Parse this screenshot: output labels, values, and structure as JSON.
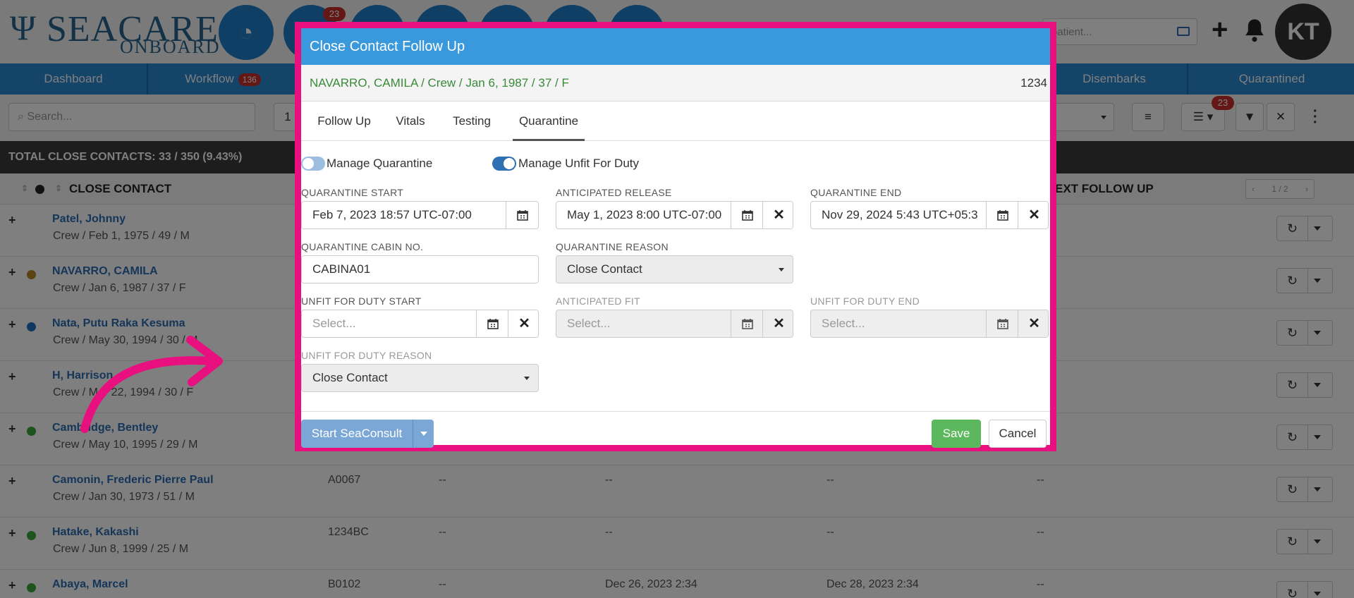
{
  "app": {
    "logo_mark": "Ψ",
    "logo_main": "SEACARE",
    "logo_sub": "ONBOARD",
    "header_badge": "23",
    "search_placeholder": "patient...",
    "user_initials": "KT"
  },
  "nav": {
    "dashboard": "Dashboard",
    "workflow": "Workflow",
    "workflow_badge": "136",
    "disembarks": "Disembarks",
    "quarantined": "Quarantined"
  },
  "toolbar": {
    "search_placeholder": "Search...",
    "list_badge": "23",
    "partial_value": "1"
  },
  "list": {
    "summary": "TOTAL CLOSE CONTACTS: 33 / 350 (9.43%)",
    "col_close_contact": "CLOSE CONTACT",
    "col_next_follow_up": "EXT FOLLOW UP",
    "pager": "1 / 2",
    "rows": [
      {
        "name": "Patel, Johnny",
        "sub": "Crew / Feb 1, 1975 / 49 / M",
        "cabin": "",
        "c1": "",
        "c2": "",
        "c3": "",
        "c4": "",
        "dot": ""
      },
      {
        "name": "NAVARRO, CAMILA",
        "sub": "Crew / Jan 6, 1987 / 37 / F",
        "cabin": "",
        "c1": "",
        "c2": "",
        "c3": "",
        "c4": "",
        "dot": "#b8872a"
      },
      {
        "name": "Nata, Putu Raka Kesuma",
        "sub": "Crew / May 30, 1994 / 30 / M",
        "cabin": "",
        "c1": "",
        "c2": "",
        "c3": "",
        "c4": "",
        "dot": "#1e6fc0"
      },
      {
        "name": "H, Harrison",
        "sub": "Crew / Mar 22, 1994 / 30 / F",
        "cabin": "",
        "c1": "",
        "c2": "",
        "c3": "",
        "c4": "",
        "dot": ""
      },
      {
        "name": "Cambridge, Bentley",
        "sub": "Crew / May 10, 1995 / 29 / M",
        "cabin": "",
        "c1": "",
        "c2": "",
        "c3": "",
        "c4": "",
        "dot": "#3aa83a"
      },
      {
        "name": "Camonin, Frederic Pierre Paul",
        "sub": "Crew / Jan 30, 1973 / 51 / M",
        "cabin": "A0067",
        "c1": "--",
        "c2": "--",
        "c3": "--",
        "c4": "--",
        "dot": ""
      },
      {
        "name": "Hatake, Kakashi",
        "sub": "Crew / Jun 8, 1999 / 25 / M",
        "cabin": "1234BC",
        "c1": "--",
        "c2": "--",
        "c3": "--",
        "c4": "--",
        "dot": "#3aa83a"
      },
      {
        "name": "Abaya, Marcel",
        "sub": "",
        "cabin": "B0102",
        "c1": "--",
        "c2": "Dec 26, 2023 2:34",
        "c3": "Dec 28, 2023 2:34",
        "c4": "--",
        "dot": "#3aa83a"
      }
    ]
  },
  "modal": {
    "title": "Close Contact Follow Up",
    "patient_info": "NAVARRO, CAMILA / Crew / Jan 6, 1987 / 37 / F",
    "patient_id": "1234",
    "tabs": [
      "Follow Up",
      "Vitals",
      "Testing",
      "Quarantine"
    ],
    "active_tab": "Quarantine",
    "toggle_quarantine": "Manage Quarantine",
    "toggle_unfit": "Manage Unfit For Duty",
    "quarantine_start_label": "QUARANTINE START",
    "quarantine_start_value": "Feb 7, 2023 18:57 UTC-07:00",
    "anticipated_release_label": "ANTICIPATED RELEASE",
    "anticipated_release_value": "May 1, 2023 8:00 UTC-07:00",
    "quarantine_end_label": "QUARANTINE END",
    "quarantine_end_value": "Nov 29, 2024 5:43 UTC+05:3",
    "cabin_label": "QUARANTINE CABIN NO.",
    "cabin_value": "CABINA01",
    "reason_label": "QUARANTINE REASON",
    "reason_value": "Close Contact",
    "unfit_start_label": "UNFIT FOR DUTY START",
    "unfit_start_placeholder": "Select...",
    "anticipated_fit_label": "ANTICIPATED FIT",
    "anticipated_fit_placeholder": "Select...",
    "unfit_end_label": "UNFIT FOR DUTY END",
    "unfit_end_placeholder": "Select...",
    "unfit_reason_label": "UNFIT FOR DUTY REASON",
    "unfit_reason_value": "Close Contact",
    "start_seaconsult": "Start SeaConsult",
    "save": "Save",
    "cancel": "Cancel"
  },
  "colors": {
    "modal_border": "#e8107f",
    "modal_header": "#3a99dd",
    "nav": "#2a88d2",
    "save": "#5cb85c",
    "toggle_on": "#2f6fb3",
    "toggle_off": "#9cbde0",
    "annotation_arrow": "#e8107f"
  }
}
